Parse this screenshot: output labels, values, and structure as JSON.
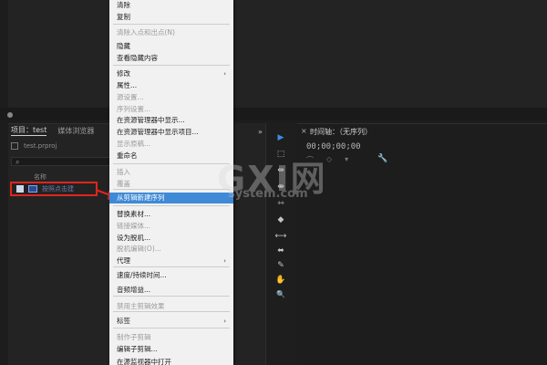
{
  "project_panel": {
    "tabs": [
      "项目：test",
      "媒体浏览器"
    ],
    "file_name": "test.prproj",
    "column_header": "名称",
    "sequence_name": "按照点击建"
  },
  "context_menu": {
    "items": [
      {
        "label": "清除",
        "disabled": false
      },
      {
        "label": "复制",
        "disabled": false
      },
      {
        "label": "清除入点和出点(N)",
        "disabled": true
      },
      {
        "label": "隐藏",
        "disabled": false
      },
      {
        "label": "查看隐藏内容",
        "disabled": false
      },
      {
        "label": "修改",
        "disabled": false,
        "submenu": true
      },
      {
        "label": "属性...",
        "disabled": false
      },
      {
        "label": "源设置...",
        "disabled": true
      },
      {
        "label": "序列设置...",
        "disabled": true
      },
      {
        "label": "在资源管理器中显示...",
        "disabled": false
      },
      {
        "label": "在资源管理器中显示项目...",
        "disabled": false
      },
      {
        "label": "显示原稿...",
        "disabled": true
      },
      {
        "label": "重命名",
        "disabled": false
      },
      {
        "label": "插入",
        "disabled": true
      },
      {
        "label": "覆盖",
        "disabled": true
      },
      {
        "label": "从剪辑新建序列",
        "disabled": false,
        "highlight": true
      },
      {
        "label": "替换素材...",
        "disabled": false
      },
      {
        "label": "链接媒体...",
        "disabled": true
      },
      {
        "label": "设为脱机...",
        "disabled": false
      },
      {
        "label": "脱机编辑(O)...",
        "disabled": true
      },
      {
        "label": "代理",
        "disabled": false,
        "submenu": true
      },
      {
        "label": "速度/持续时间...",
        "disabled": false
      },
      {
        "label": "音频增益...",
        "disabled": false
      },
      {
        "label": "禁用主剪辑效果",
        "disabled": true
      },
      {
        "label": "标签",
        "disabled": false,
        "submenu": true
      },
      {
        "label": "制作子剪辑",
        "disabled": true
      },
      {
        "label": "编辑子剪辑...",
        "disabled": false
      },
      {
        "label": "在源监视器中打开",
        "disabled": false
      }
    ],
    "submenu_glyph": "›"
  },
  "tools": {
    "glyphs": [
      "▶",
      "⬚",
      "⇹",
      "⇼",
      "⇿",
      "◆",
      "⟷",
      "⬌",
      "✎",
      "✋",
      "🔍"
    ],
    "more_glyph": "»"
  },
  "timeline": {
    "close_glyph": "×",
    "title": "时间轴：（无序列）",
    "menu_glyph": "≡",
    "timecode": "00;00;00;00",
    "wrench_glyph": "🔧"
  },
  "watermark": {
    "big": "GXI网",
    "small": "system.com"
  },
  "colors": {
    "highlight": "#3f8ad6",
    "selection_border": "#e1251b",
    "active_tool": "#3d8ce6"
  }
}
